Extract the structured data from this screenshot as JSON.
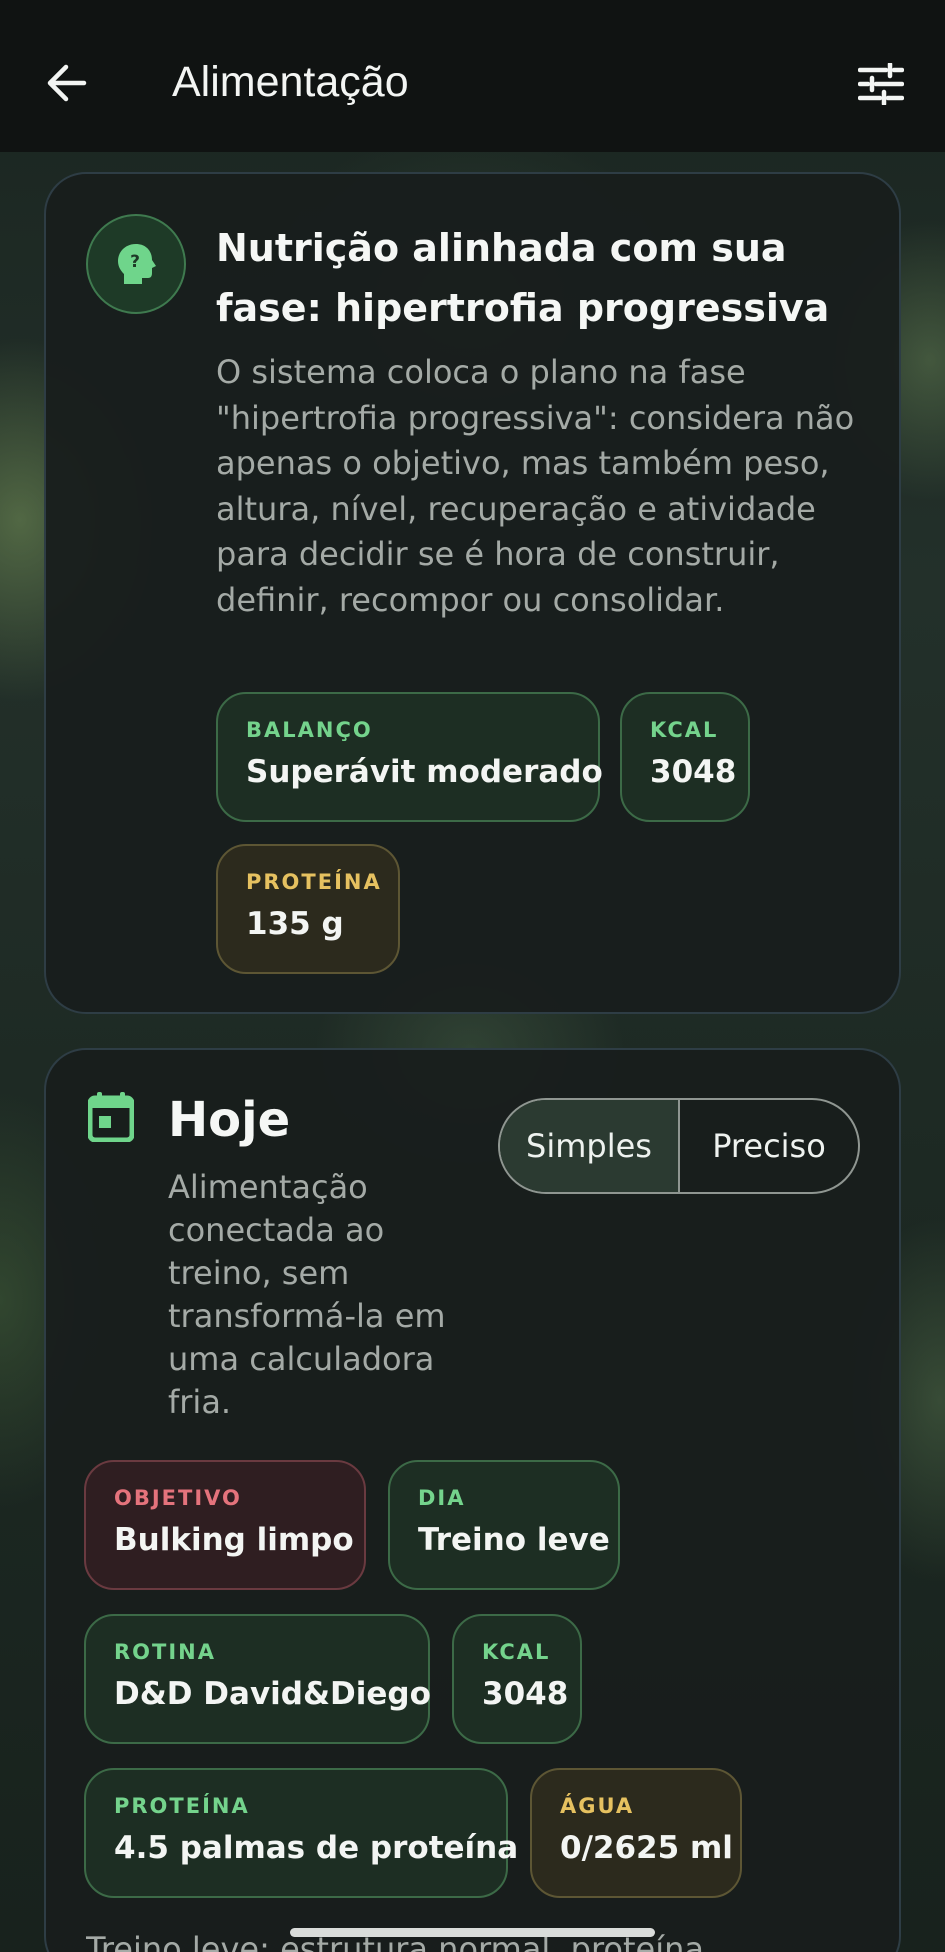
{
  "header": {
    "title": "Alimentação",
    "back_icon": "arrow-left-icon",
    "filter_icon": "sliders-icon"
  },
  "phase_card": {
    "icon": "help-head-icon",
    "title": "Nutrição alinhada com sua fase: hipertrofia progressiva",
    "description": "O sistema coloca o plano na fase \"hipertrofia progressiva\": considera não apenas o objetivo, mas também peso, altura, nível, recuperação e atividade para decidir se é hora de construir, definir, recompor ou consolidar.",
    "chips": [
      {
        "label": "BALANÇO",
        "value": "Superávit moderado"
      },
      {
        "label": "KCAL",
        "value": "3048"
      },
      {
        "label": "PROTEÍNA",
        "value": "135 g"
      }
    ]
  },
  "today_card": {
    "icon": "calendar-icon",
    "title": "Hoje",
    "description": "Alimentação conectada ao treino, sem transformá-la em uma calculadora fria.",
    "mode_toggle": {
      "options": [
        "Simples",
        "Preciso"
      ],
      "selected": "Simples"
    },
    "chips": [
      {
        "label": "OBJETIVO",
        "value": "Bulking limpo"
      },
      {
        "label": "DIA",
        "value": "Treino leve"
      },
      {
        "label": "ROTINA",
        "value": "D&D David&Diego"
      },
      {
        "label": "KCAL",
        "value": "3048"
      },
      {
        "label": "PROTEÍNA",
        "value": "4.5 palmas de proteína"
      },
      {
        "label": "ÁGUA",
        "value": "0/2625 ml"
      }
    ],
    "footer_text": "Treino leve: estrutura normal, proteína"
  },
  "colors": {
    "accent_green": "#74d38c",
    "accent_gold": "#e6c160",
    "accent_red": "#e4737c"
  }
}
